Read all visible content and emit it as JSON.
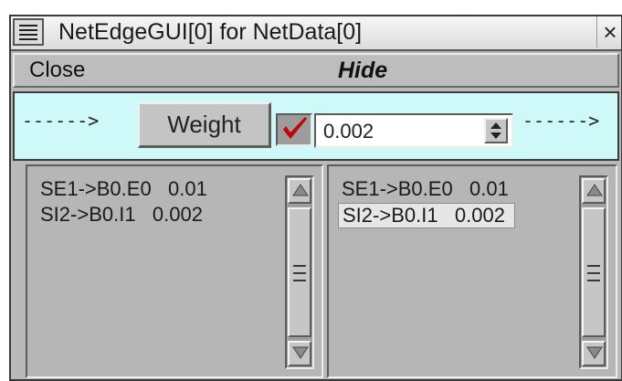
{
  "window": {
    "title": "NetEdgeGUI[0] for NetData[0]",
    "close_glyph": "×"
  },
  "menu": {
    "close_label": "Close",
    "hide_label": "Hide"
  },
  "controls": {
    "left_arrow": "------>",
    "weight_label": "Weight",
    "checkbox_checked": true,
    "value": "0.002",
    "right_arrow": "------>"
  },
  "lists": {
    "left": [
      {
        "text": "SE1->B0.E0   0.01"
      },
      {
        "text": "SI2->B0.I1   0.002"
      }
    ],
    "right": [
      {
        "text": "SE1->B0.E0   0.01"
      },
      {
        "text": "SI2->B0.I1   0.002",
        "selected": true
      }
    ]
  },
  "colors": {
    "control_row_bg": "#cff8f8",
    "panel_bg": "#b9b9b9",
    "check_mark": "#c40000"
  },
  "icons": {
    "window_menu": "menu-lines-icon",
    "checkbox": "checkmark-icon",
    "spinner": "up-down-spinner-icon",
    "scroll_up": "triangle-up-icon",
    "scroll_down": "triangle-down-icon"
  }
}
